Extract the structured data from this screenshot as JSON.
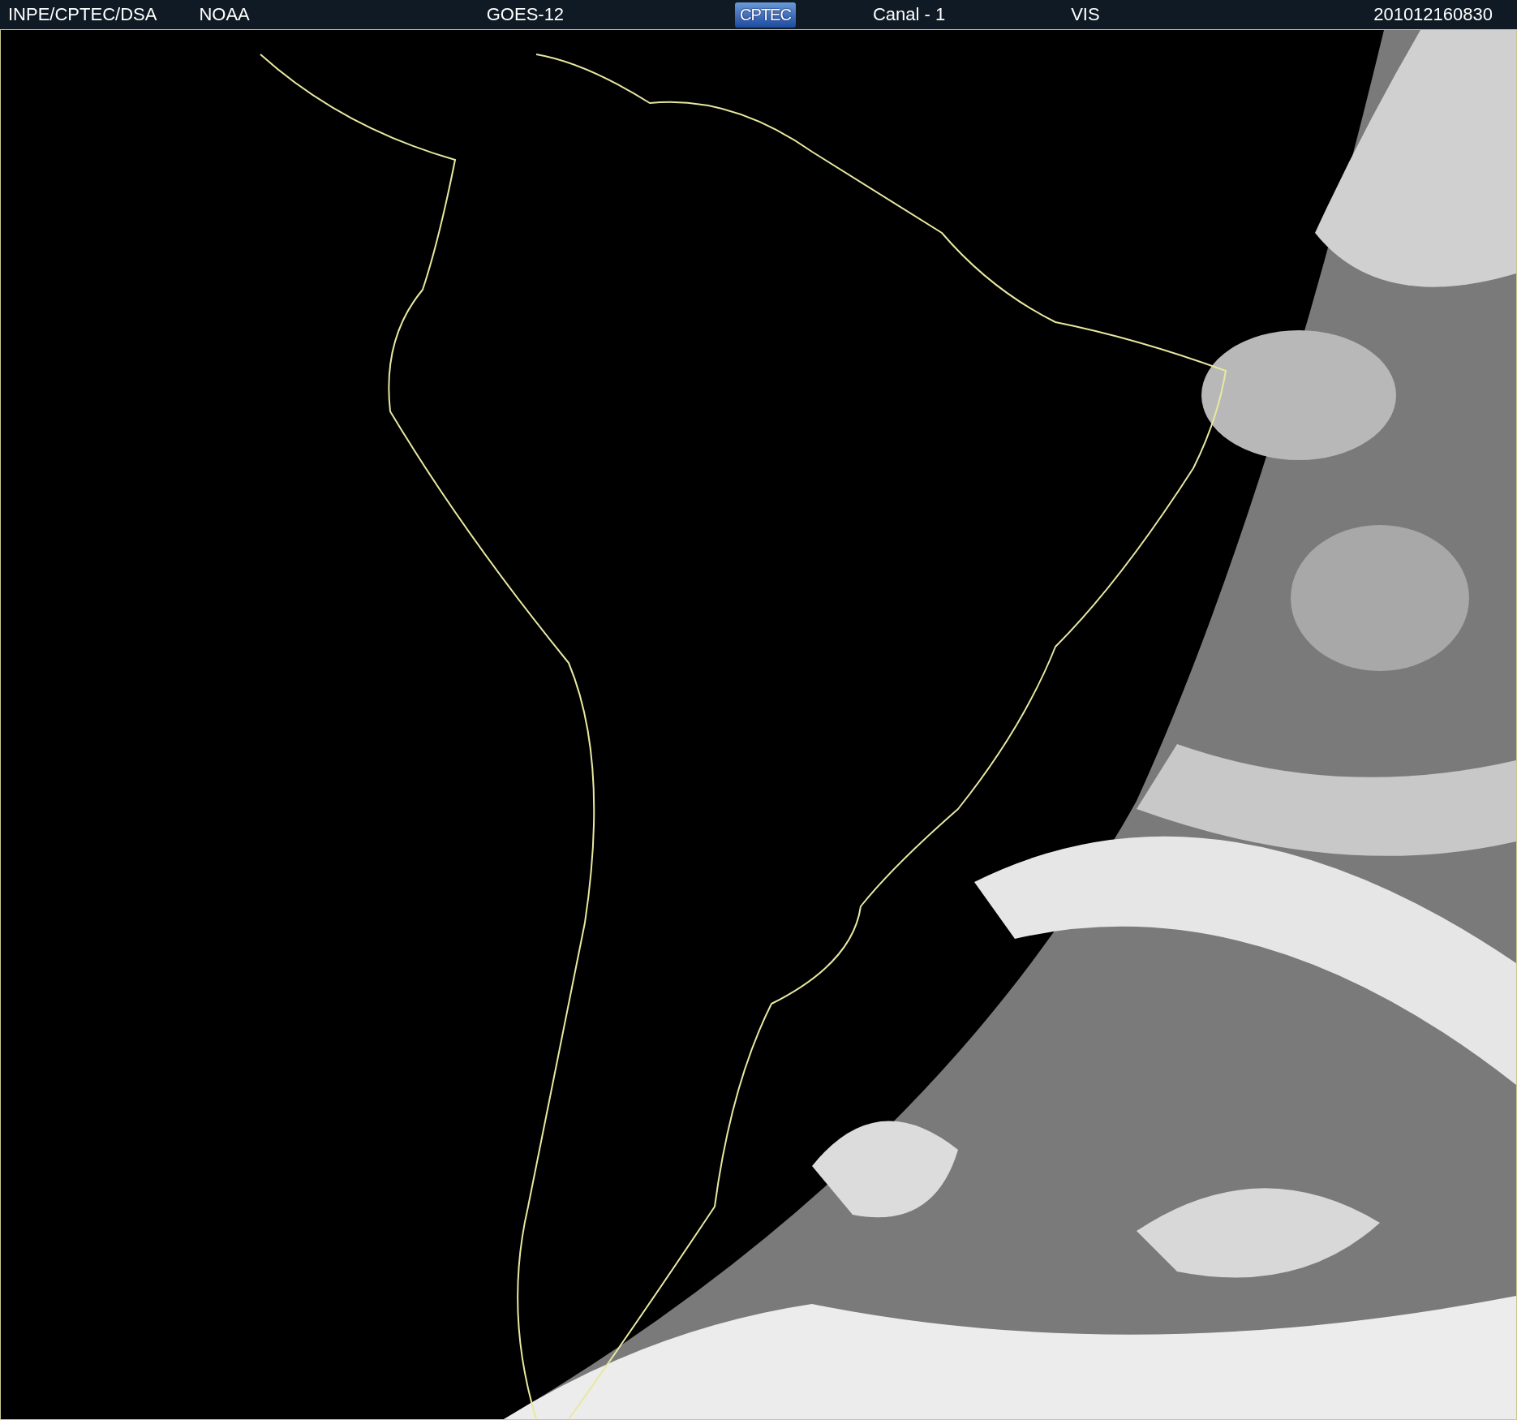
{
  "header": {
    "source": "INPE/CPTEC/DSA",
    "agency": "NOAA",
    "satellite": "GOES-12",
    "logo": "CPTEC",
    "channel": "Canal - 1",
    "band": "VIS",
    "timestamp": "201012160830"
  }
}
